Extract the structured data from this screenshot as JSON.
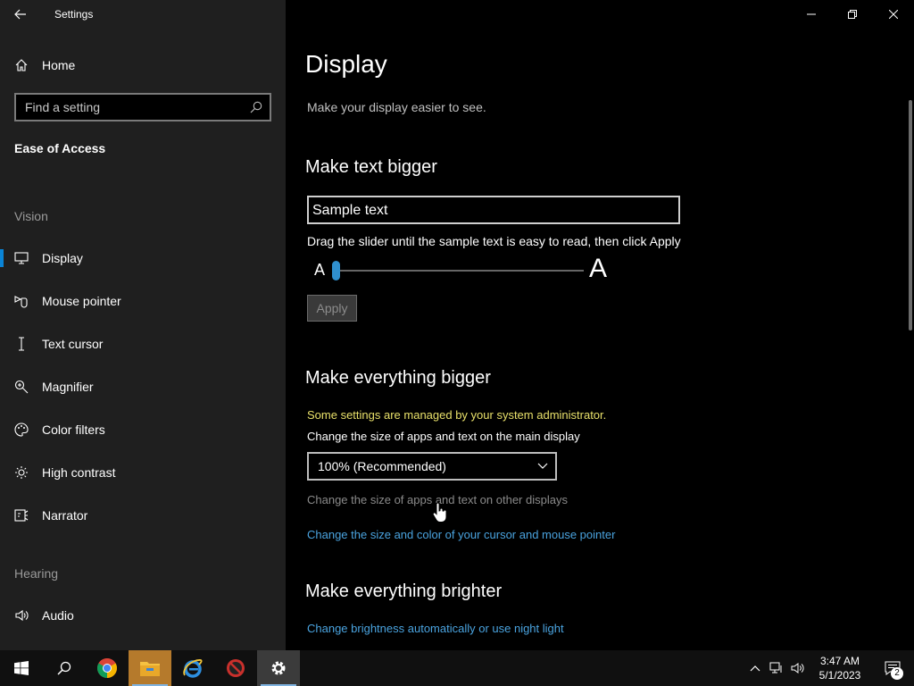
{
  "app": {
    "title": "Settings"
  },
  "sidebar": {
    "home_label": "Home",
    "search_placeholder": "Find a setting",
    "section_title": "Ease of Access",
    "groups": {
      "vision": "Vision",
      "hearing": "Hearing"
    },
    "items": [
      {
        "label": "Display",
        "icon": "monitor-icon"
      },
      {
        "label": "Mouse pointer",
        "icon": "mouse-pointer-icon"
      },
      {
        "label": "Text cursor",
        "icon": "text-cursor-icon"
      },
      {
        "label": "Magnifier",
        "icon": "magnifier-icon"
      },
      {
        "label": "Color filters",
        "icon": "palette-icon"
      },
      {
        "label": "High contrast",
        "icon": "sun-icon"
      },
      {
        "label": "Narrator",
        "icon": "narrator-icon"
      },
      {
        "label": "Audio",
        "icon": "speaker-icon"
      }
    ]
  },
  "main": {
    "title": "Display",
    "description": "Make your display easier to see.",
    "text_bigger": {
      "heading": "Make text bigger",
      "sample_text": "Sample text",
      "instruction": "Drag the slider until the sample text is easy to read, then click Apply",
      "slider_min_label": "A",
      "slider_max_label": "A",
      "slider_value_fraction": 0.0,
      "apply_label": "Apply"
    },
    "everything_bigger": {
      "heading": "Make everything bigger",
      "admin_warning": "Some settings are managed by your system administrator.",
      "size_label": "Change the size of apps and text on the main display",
      "size_value": "100% (Recommended)",
      "other_displays": "Change the size of apps and text on other displays",
      "cursor_link": "Change the size and color of your cursor and mouse pointer"
    },
    "everything_brighter": {
      "heading": "Make everything brighter",
      "brightness_link": "Change brightness automatically or use night light"
    }
  },
  "taskbar": {
    "apps": [
      "start-icon",
      "search-icon",
      "chrome-icon",
      "file-explorer-icon",
      "internet-explorer-icon",
      "blocked-app-icon",
      "settings-icon"
    ],
    "clock_time": "3:47 AM",
    "clock_date": "5/1/2023",
    "notification_count": "2"
  },
  "colors": {
    "accent": "#0a84d6",
    "link": "#4aa3df",
    "warning": "#e8e06a",
    "sidebar_bg": "#1f1f1f"
  }
}
